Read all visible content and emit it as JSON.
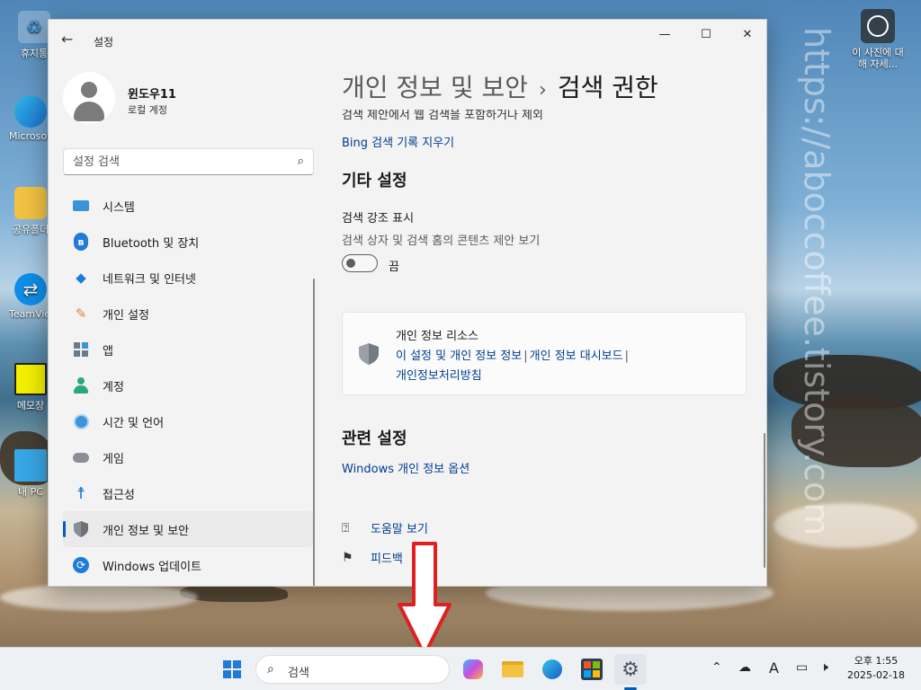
{
  "desktop": {
    "icons": [
      {
        "label": "휴지통"
      },
      {
        "label": "Microsoft Edge"
      },
      {
        "label": "공유폴더"
      },
      {
        "label": "TeamViewer"
      },
      {
        "label": "메모장"
      },
      {
        "label": "내 PC"
      }
    ],
    "photo_info": "이 사진에 대해 자세..."
  },
  "window": {
    "app_title": "설정",
    "controls": {
      "minimize": "—",
      "maximize": "☐",
      "close": "✕"
    }
  },
  "nav": {
    "user": {
      "name": "윈도우11",
      "account_type": "로컬 계정"
    },
    "search_placeholder": "설정 검색",
    "items": [
      {
        "label": "시스템",
        "icon": "system-icon"
      },
      {
        "label": "Bluetooth 및 장치",
        "icon": "bluetooth-icon"
      },
      {
        "label": "네트워크 및 인터넷",
        "icon": "network-icon"
      },
      {
        "label": "개인 설정",
        "icon": "brush-icon"
      },
      {
        "label": "앱",
        "icon": "apps-icon"
      },
      {
        "label": "계정",
        "icon": "account-icon"
      },
      {
        "label": "시간 및 언어",
        "icon": "clock-globe-icon"
      },
      {
        "label": "게임",
        "icon": "gamepad-icon"
      },
      {
        "label": "접근성",
        "icon": "accessibility-icon"
      },
      {
        "label": "개인 정보 및 보안",
        "icon": "shield-icon",
        "active": true
      },
      {
        "label": "Windows 업데이트",
        "icon": "update-icon"
      }
    ]
  },
  "content": {
    "breadcrumb": {
      "parent": "개인 정보 및 보안",
      "separator": "›",
      "current": "검색 권한"
    },
    "cut_text": "검색 제안에서 웹 검색을 포함하거나 제외",
    "bing_link": "Bing 검색 기록 지우기",
    "other_settings_title": "기타 설정",
    "highlight": {
      "title": "검색 강조 표시",
      "description": "검색 상자 및 검색 홈의 콘텐츠 제안 보기",
      "state": "끔"
    },
    "privacy_card": {
      "title": "개인 정보 리소스",
      "links": [
        "이 설정 및 개인 정보 정보",
        "개인 정보 대시보드",
        "개인정보처리방침"
      ],
      "separator": "|"
    },
    "related_title": "관련 설정",
    "related_link": "Windows 개인 정보 옵션",
    "help": "도움말 보기",
    "feedback": "피드백"
  },
  "taskbar": {
    "search_text": "검색",
    "ime": "A",
    "time": "오후 1:55",
    "date": "2025-02-18"
  },
  "watermark": "https://aboccoffee.tistory.com",
  "colors": {
    "accent": "#005fb8",
    "link": "#003e92",
    "arrow": "#e02020"
  }
}
